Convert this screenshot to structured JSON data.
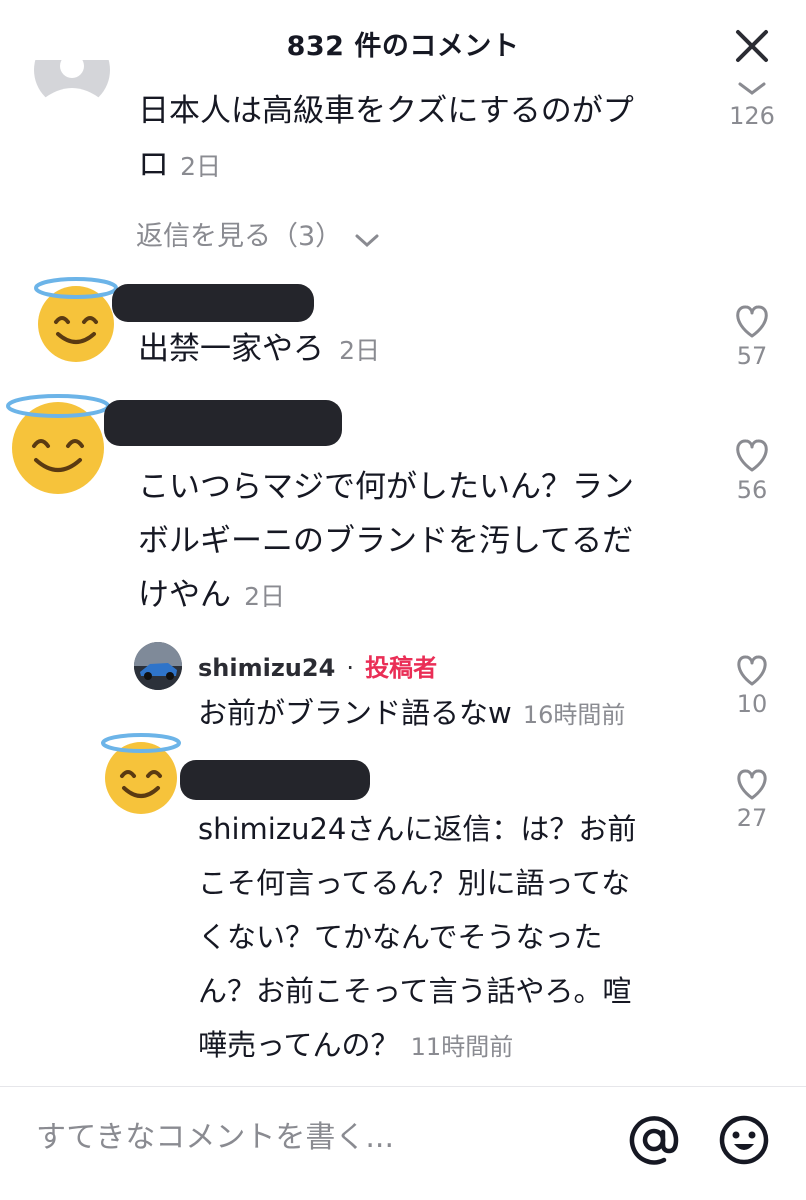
{
  "header": {
    "title": "832 件のコメント"
  },
  "comments": [
    {
      "text_line1": "日本人は高級車をクズにするのがプ",
      "text_line2": "ロ",
      "time": "2日",
      "likes": "126",
      "view_replies": "返信を見る（3）"
    },
    {
      "text": "出禁一家やろ",
      "time": "2日",
      "likes": "57"
    },
    {
      "text_line1": "こいつらマジで何がしたいん？ラン",
      "text_line2": "ボルギーニのブランドを汚してるだ",
      "text_line3": "けやん",
      "time": "2日",
      "likes": "56"
    }
  ],
  "replies": [
    {
      "username": "shimizu24",
      "separator": "·",
      "badge": "投稿者",
      "text": "お前がブランド語るなw",
      "time": "16時間前",
      "likes": "10"
    },
    {
      "text_line1": "shimizu24さんに返信：は？お前",
      "text_line2": "こそ何言ってるん？別に語ってな",
      "text_line3": "くない？てかなんでそうなった",
      "text_line4": "ん？お前こそって言う話やろ。喧",
      "text_line5": "嘩売ってんの？",
      "time": "11時間前",
      "likes": "27"
    }
  ],
  "footer": {
    "placeholder": "すてきなコメントを書く..."
  },
  "colors": {
    "accent_badge": "#ea2e56",
    "muted": "#8a8b91",
    "text": "#161823",
    "emoji_yellow": "#f6c33b",
    "halo_blue": "#6cb4e8"
  },
  "icons": [
    "close-icon",
    "chevron-down-icon",
    "heart-outline-icon",
    "at-sign-icon",
    "emoji-smile-icon"
  ]
}
